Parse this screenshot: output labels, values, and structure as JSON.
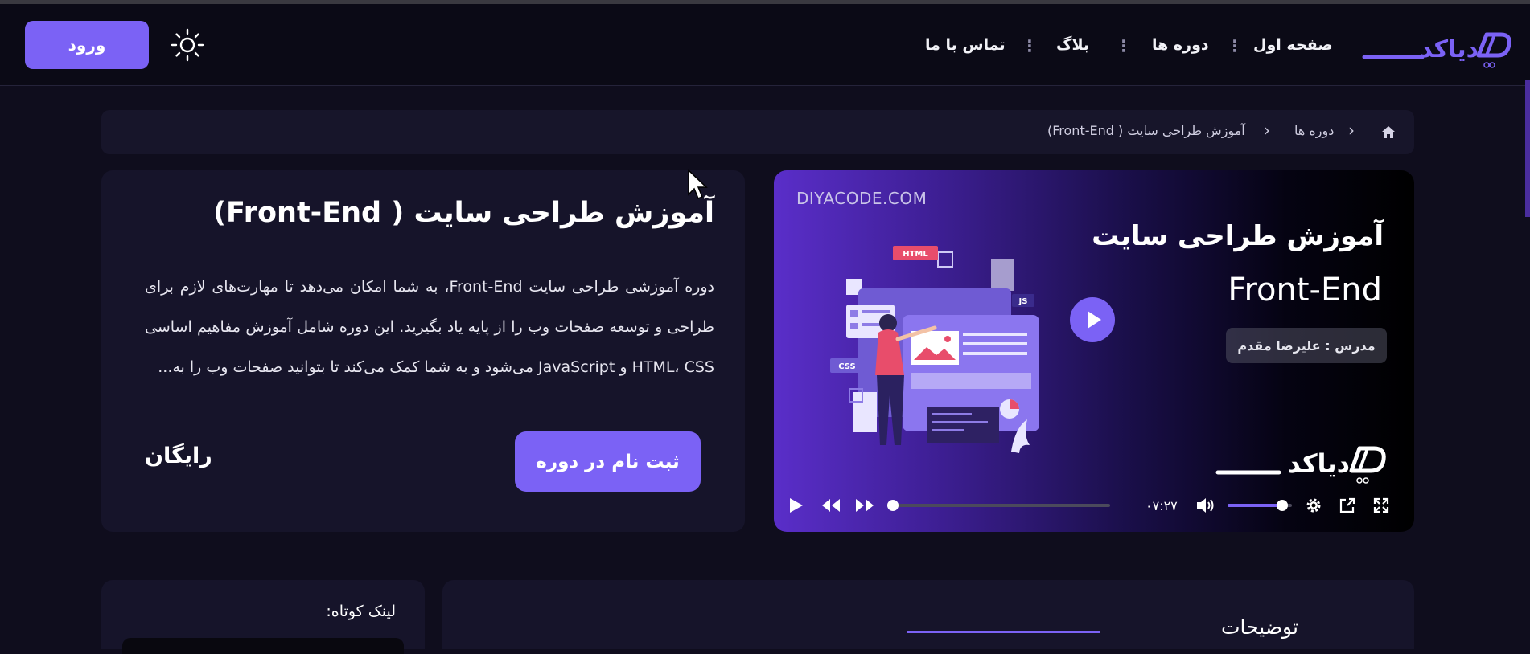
{
  "header": {
    "login_label": "ورود",
    "nav": {
      "home": "صفحه اول",
      "courses": "دوره ها",
      "blog": "بلاگ",
      "contact": "تماس با ما"
    },
    "logo_text": "دیاکد",
    "theme_icon": "sun-icon"
  },
  "breadcrumb": {
    "home_icon": "home-icon",
    "courses": "دوره ها",
    "current": "آموزش طراحی سایت ( Front-End)"
  },
  "course": {
    "title": "آموزش طراحی سایت ( Front-End)",
    "description": "دوره آموزشی طراحی سایت Front-End، به شما امکان می‌دهد تا مهارت‌های لازم برای طراحی و توسعه صفحات وب را از پایه یاد بگیرید. این دوره شامل آموزش مفاهیم اساسی HTML، CSS و JavaScript می‌شود و به شما کمک می‌کند تا بتوانید صفحات وب را به...",
    "register_label": "ثبت نام در دوره",
    "price": "رایگان"
  },
  "video": {
    "site": "DIYACODE.COM",
    "title": "آموزش طراحی سایت",
    "subtitle": "Front-End",
    "teacher": "مدرس : علیرضا مقدم",
    "logo_text": "دیاکد",
    "time": "۰۷:۲۷",
    "progress": 0.0,
    "volume": 0.85,
    "tags": {
      "html": "HTML",
      "js": "JS",
      "css": "CSS"
    }
  },
  "sidebar": {
    "short_link_label": "لینک کوتاه:"
  },
  "tabs": {
    "description": "توضیحات"
  },
  "colors": {
    "accent": "#7b62f5",
    "background": "#0f0d1d",
    "card": "#16142a"
  }
}
